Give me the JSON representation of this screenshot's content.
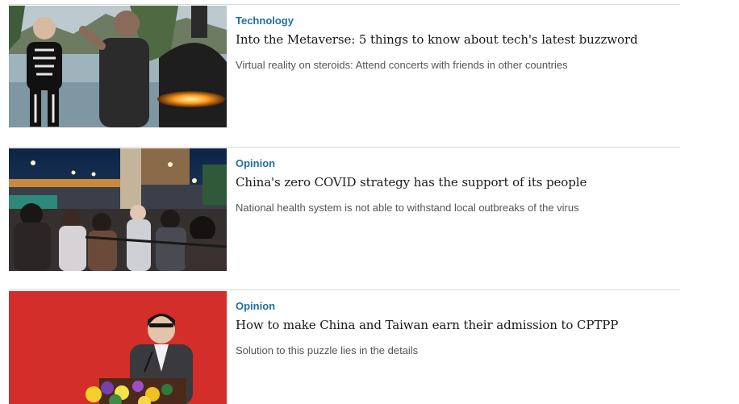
{
  "articles": [
    {
      "category": "Technology",
      "headline": "Into the Metaverse: 5 things to know about tech's latest buzzword",
      "summary": "Virtual reality on steroids: Attend concerts with friends in other countries",
      "image": "metaverse-photo"
    },
    {
      "category": "Opinion",
      "headline": "China's zero COVID strategy has the support of its people",
      "summary": "National health system is not able to withstand local outbreaks of the virus",
      "image": "covid-crowd-photo"
    },
    {
      "category": "Opinion",
      "headline": "How to make China and Taiwan earn their admission to CPTPP",
      "summary": "Solution to this puzzle lies in the details",
      "image": "speaker-podium-photo"
    }
  ],
  "colors": {
    "category": "#1f6fa8",
    "headline": "#1a1a1a",
    "summary": "#555555",
    "divider": "#d9d9d9"
  }
}
